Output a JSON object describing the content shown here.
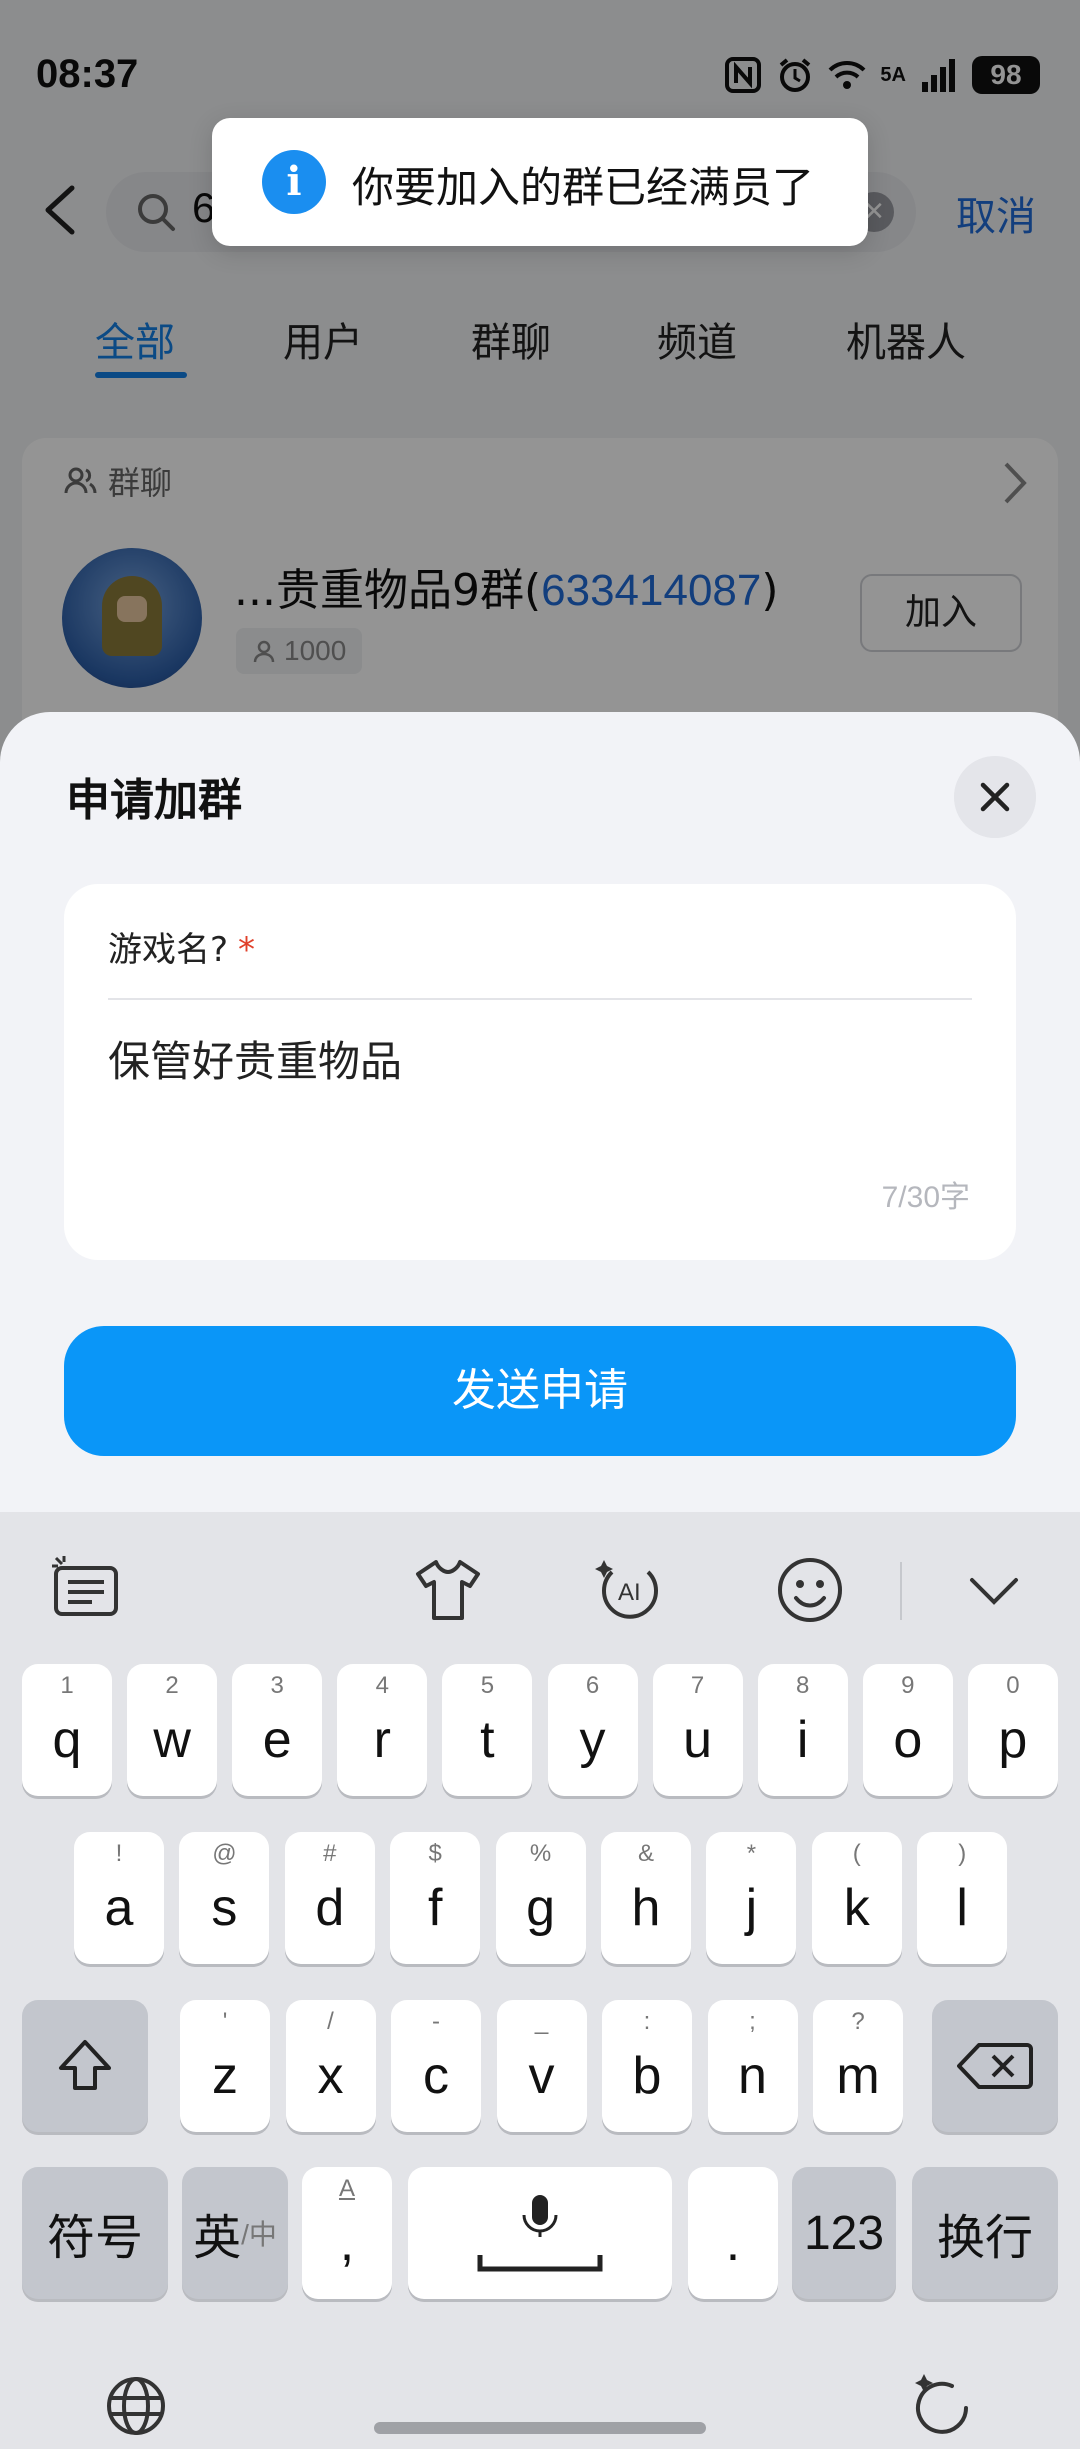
{
  "status_bar": {
    "time": "08:37",
    "network": "5A",
    "battery": "98"
  },
  "search": {
    "query": "6",
    "cancel_label": "取消"
  },
  "tabs": [
    "全部",
    "用户",
    "群聊",
    "频道",
    "机器人"
  ],
  "result_card": {
    "section_label": "群聊",
    "group_name": "...贵重物品9群(",
    "group_id": "633414087",
    "group_name_close": ")",
    "member_count": "1000",
    "join_label": "加入"
  },
  "toast": {
    "message": "你要加入的群已经满员了",
    "icon": "info-icon"
  },
  "sheet": {
    "title": "申请加群",
    "question": "游戏名?",
    "required_mark": "*",
    "answer": "保管好贵重物品",
    "char_count": "7/30字",
    "send_label": "发送申请"
  },
  "keyboard": {
    "row1": [
      {
        "main": "q",
        "sub": "1"
      },
      {
        "main": "w",
        "sub": "2"
      },
      {
        "main": "e",
        "sub": "3"
      },
      {
        "main": "r",
        "sub": "4"
      },
      {
        "main": "t",
        "sub": "5"
      },
      {
        "main": "y",
        "sub": "6"
      },
      {
        "main": "u",
        "sub": "7"
      },
      {
        "main": "i",
        "sub": "8"
      },
      {
        "main": "o",
        "sub": "9"
      },
      {
        "main": "p",
        "sub": "0"
      }
    ],
    "row2": [
      {
        "main": "a",
        "sub": "!"
      },
      {
        "main": "s",
        "sub": "@"
      },
      {
        "main": "d",
        "sub": "#"
      },
      {
        "main": "f",
        "sub": "$"
      },
      {
        "main": "g",
        "sub": "%"
      },
      {
        "main": "h",
        "sub": "&"
      },
      {
        "main": "j",
        "sub": "*"
      },
      {
        "main": "k",
        "sub": "("
      },
      {
        "main": "l",
        "sub": ")"
      }
    ],
    "row3": [
      {
        "main": "z",
        "sub": "'"
      },
      {
        "main": "x",
        "sub": "/"
      },
      {
        "main": "c",
        "sub": "-"
      },
      {
        "main": "v",
        "sub": "_"
      },
      {
        "main": "b",
        "sub": ":"
      },
      {
        "main": "n",
        "sub": ";"
      },
      {
        "main": "m",
        "sub": "?"
      }
    ],
    "symbols_label": "符号",
    "lang_label": "英",
    "lang_alt": "/中",
    "comma_sub": "A",
    "comma": ",",
    "period": ".",
    "num_label": "123",
    "enter_label": "换行"
  }
}
